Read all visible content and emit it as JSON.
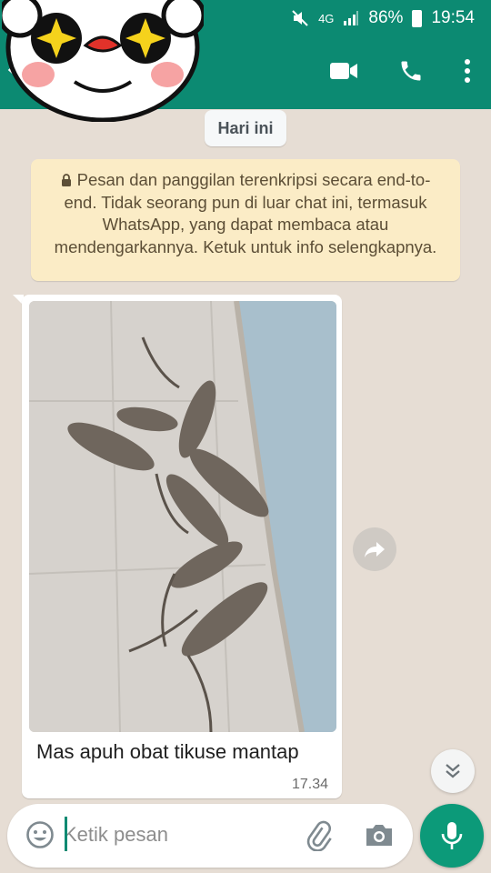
{
  "status_bar": {
    "network": "4G",
    "battery": "86%",
    "time": "19:54"
  },
  "app_bar": {
    "icons": [
      "back-arrow-icon",
      "video-call-icon",
      "voice-call-icon",
      "more-options-icon"
    ]
  },
  "chat": {
    "date_chip": "Hari ini",
    "encryption_notice": "Pesan dan panggilan terenkripsi secara end-to-end. Tidak seorang pun di luar chat ini, termasuk WhatsApp, yang dapat membaca atau mendengarkannya. Ketuk untuk info selengkapnya.",
    "messages": [
      {
        "type": "image",
        "caption": "Mas apuh obat tikuse mantap",
        "time": "17.34"
      }
    ]
  },
  "composer": {
    "placeholder": "Ketik pesan",
    "icons": [
      "emoji-icon",
      "attach-icon",
      "camera-icon",
      "mic-icon"
    ]
  },
  "colors": {
    "header": "#0c8a72",
    "chat_background": "#e6ddd4",
    "notice_background": "#fbecc6",
    "mic_button": "#0c9a79"
  }
}
